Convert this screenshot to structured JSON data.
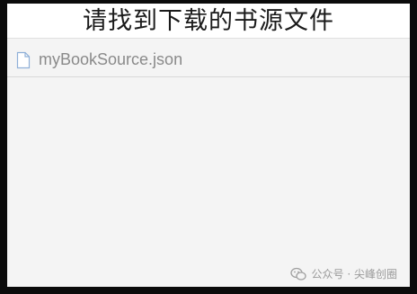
{
  "header": {
    "title": "请找到下载的书源文件"
  },
  "files": [
    {
      "name": "myBookSource.json",
      "icon": "file-icon"
    }
  ],
  "watermark": {
    "text": "公众号 · 尖峰创圈",
    "icon": "wechat-icon"
  }
}
